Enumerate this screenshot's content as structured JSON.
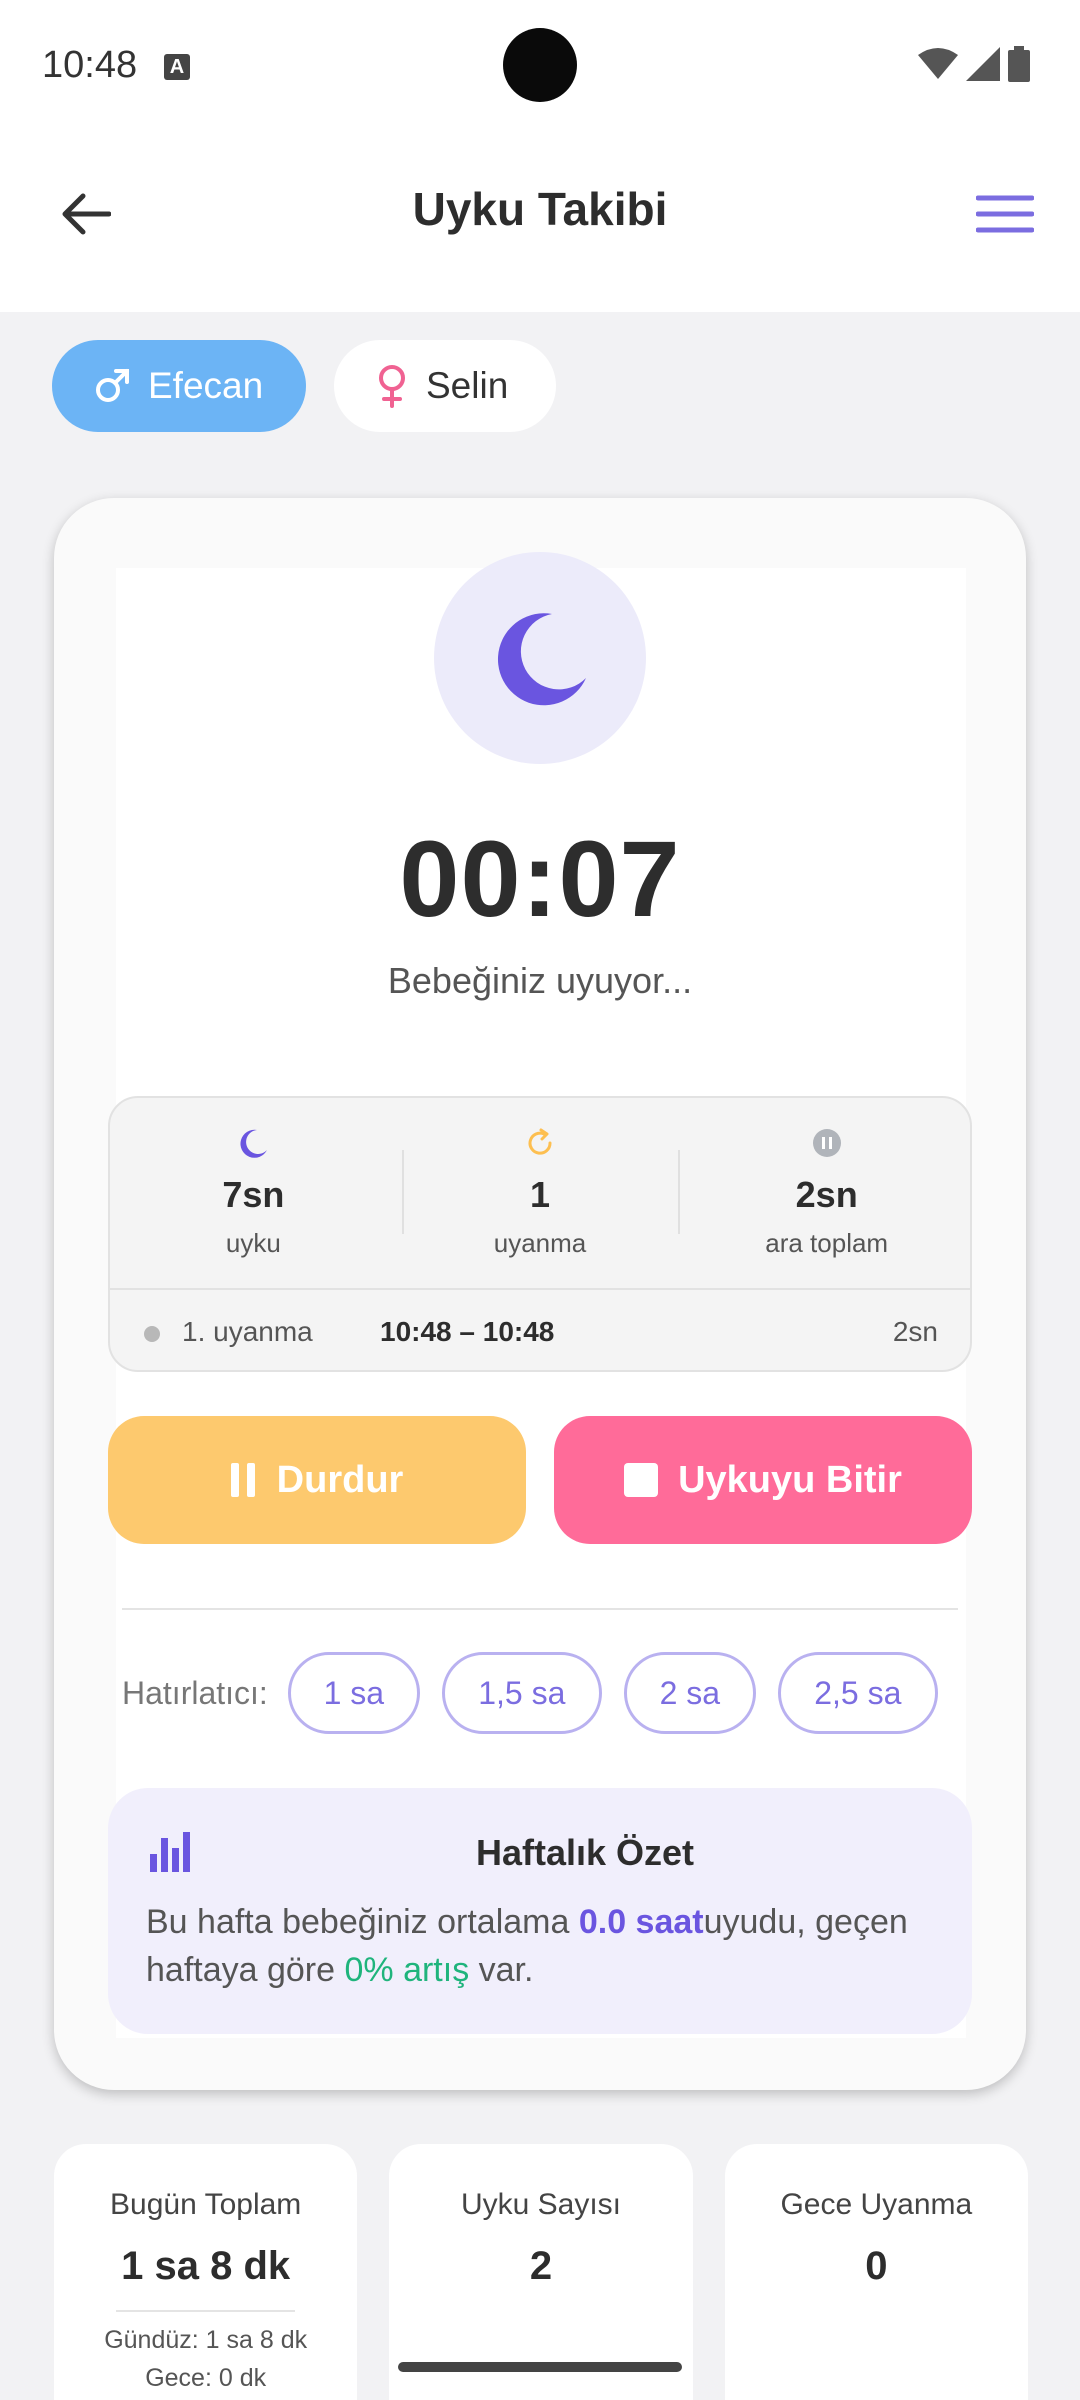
{
  "status_bar": {
    "time": "10:48",
    "notification_letter": "A"
  },
  "app_bar": {
    "title": "Uyku Takibi"
  },
  "babies": [
    {
      "name": "Efecan",
      "gender": "male",
      "active": true
    },
    {
      "name": "Selin",
      "gender": "female",
      "active": false
    }
  ],
  "timer": {
    "value": "00:07",
    "status": "Bebeğiniz uyuyor..."
  },
  "stats": {
    "sleep": {
      "value": "7sn",
      "label": "uyku"
    },
    "wakeups": {
      "value": "1",
      "label": "uyanma"
    },
    "break_total": {
      "value": "2sn",
      "label": "ara toplam"
    }
  },
  "wake_log": [
    {
      "label": "1. uyanma",
      "time": "10:48 – 10:48",
      "duration": "2sn"
    }
  ],
  "actions": {
    "pause": "Durdur",
    "stop": "Uykuyu Bitir"
  },
  "reminder": {
    "label": "Hatırlatıcı:",
    "options": [
      "1 sa",
      "1,5 sa",
      "2 sa",
      "2,5 sa"
    ]
  },
  "weekly_summary": {
    "title": "Haftalık Özet",
    "text_1": "Bu hafta bebeğiniz ortalama ",
    "avg": "0.0 saat",
    "text_2": "uyudu, geçen haftaya göre ",
    "change": "0% artış",
    "text_3": " var."
  },
  "summary_cards": [
    {
      "title": "Bugün Toplam",
      "value": "1 sa 8 dk",
      "sub1": "Gündüz: 1 sa 8 dk",
      "sub2": "Gece: 0 dk"
    },
    {
      "title": "Uyku Sayısı",
      "value": "2"
    },
    {
      "title": "Gece Uyanma",
      "value": "0"
    }
  ],
  "colors": {
    "accent": "#6a55e0",
    "active_chip": "#6cb4f5",
    "pause_button": "#fdc96e",
    "stop_button": "#ff6b99",
    "positive": "#1fb47c"
  }
}
